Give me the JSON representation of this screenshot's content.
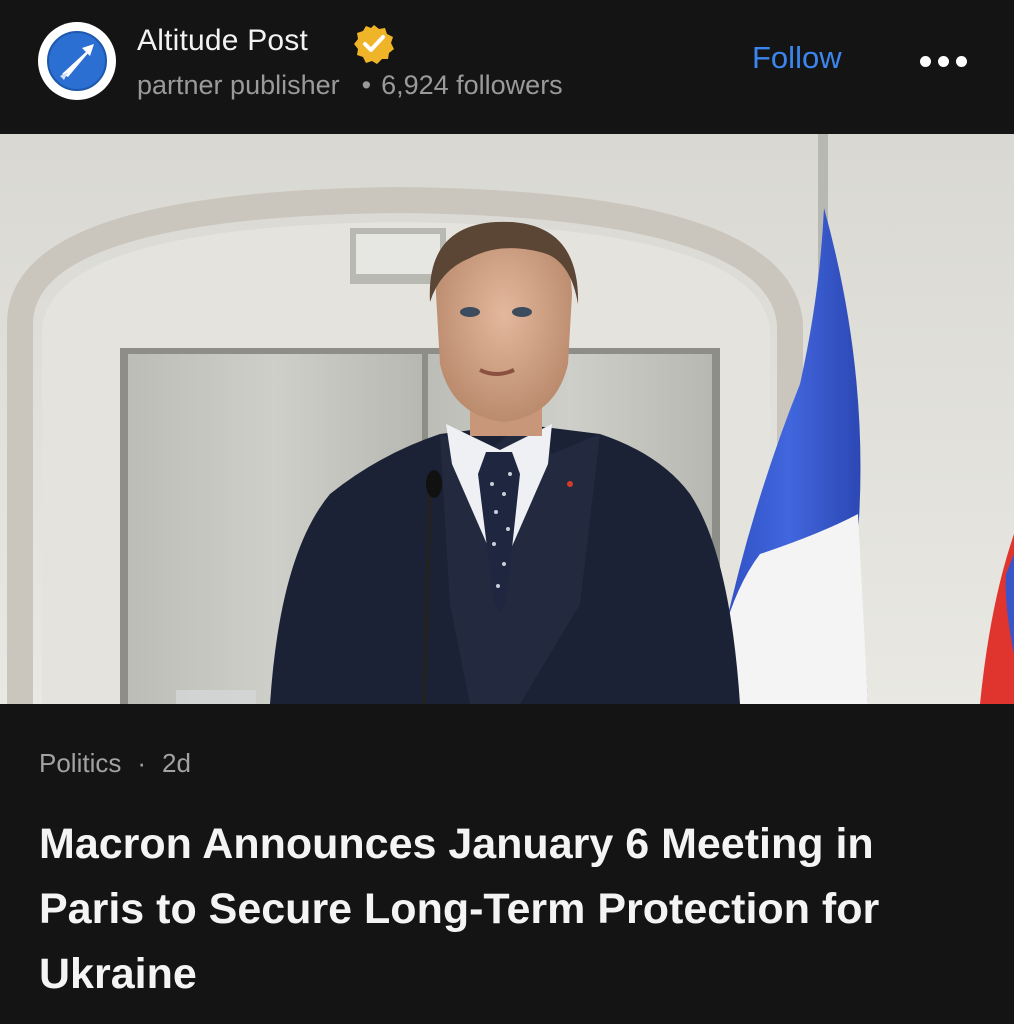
{
  "publisher": {
    "name": "Altitude Post",
    "verified_icon": "verified-badge-icon",
    "avatar_icon": "paper-plane-logo",
    "tier": "partner publisher",
    "separator": "•",
    "followers": "6,924 followers"
  },
  "actions": {
    "follow_label": "Follow",
    "more_icon": "more-options-icon"
  },
  "article": {
    "image_alt": "Man in dark suit and polka-dot tie speaking at a microphone in front of a French flag",
    "category": "Politics",
    "separator": "·",
    "age": "2d",
    "headline": "Macron Announces January 6 Meeting in Paris to Secure Long-Term Protection for Ukraine"
  },
  "colors": {
    "background": "#141414",
    "accent": "#3b86ee",
    "verified": "#f0b429",
    "flag_blue": "#2f4fc6",
    "flag_white": "#f3f3f3",
    "flag_red": "#e0342e"
  }
}
